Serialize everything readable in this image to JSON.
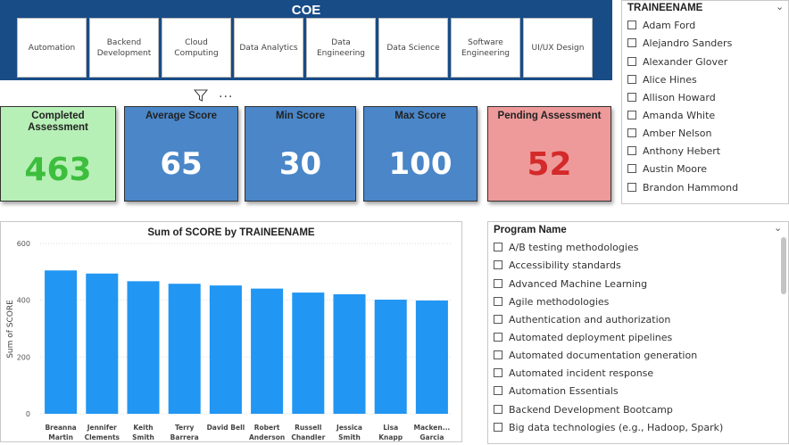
{
  "coe": {
    "title": "COE",
    "buttons": [
      "Automation",
      "Backend Development",
      "Cloud Computing",
      "Data Analytics",
      "Data Engineering",
      "Data Science",
      "Software Engineering",
      "UI/UX Design"
    ]
  },
  "toolbar": {
    "more": "..."
  },
  "kpis": {
    "completed": {
      "label": "Completed Assessment",
      "value": "463",
      "bg": "#b7f0b7",
      "fg": "#3dbe3d"
    },
    "average": {
      "label": "Average Score",
      "value": "65",
      "bg": "#4a86c8",
      "fg": "#ffffff"
    },
    "min": {
      "label": "Min Score",
      "value": "30",
      "bg": "#4a86c8",
      "fg": "#ffffff"
    },
    "max": {
      "label": "Max Score",
      "value": "100",
      "bg": "#4a86c8",
      "fg": "#ffffff"
    },
    "pending": {
      "label": "Pending Assessment",
      "value": "52",
      "bg": "#ee9a9a",
      "fg": "#d42a2a"
    }
  },
  "trainee_slicer": {
    "title": "TRAINEENAME",
    "items": [
      "Adam Ford",
      "Alejandro Sanders",
      "Alexander Glover",
      "Alice Hines",
      "Allison Howard",
      "Amanda White",
      "Amber Nelson",
      "Anthony Hebert",
      "Austin Moore",
      "Brandon Hammond"
    ]
  },
  "program_slicer": {
    "title": "Program Name",
    "items": [
      "A/B testing methodologies",
      "Accessibility standards",
      "Advanced Machine Learning",
      "Agile methodologies",
      "Authentication and authorization",
      "Automated deployment pipelines",
      "Automated documentation generation",
      "Automated incident response",
      "Automation Essentials",
      "Backend Development Bootcamp",
      "Big data technologies (e.g., Hadoop, Spark)"
    ]
  },
  "chart_data": {
    "type": "bar",
    "title": "Sum of SCORE by TRAINEENAME",
    "xlabel": "",
    "ylabel": "Sum of SCORE",
    "categories": [
      [
        "Breanna",
        "Martin"
      ],
      [
        "Jennifer",
        "Clements"
      ],
      [
        "Keith",
        "Smith"
      ],
      [
        "Terry",
        "Barrera"
      ],
      [
        "David Bell"
      ],
      [
        "Robert",
        "Anderson"
      ],
      [
        "Russell",
        "Chandler"
      ],
      [
        "Jessica",
        "Smith"
      ],
      [
        "Lisa",
        "Knapp"
      ],
      [
        "Macken...",
        "Garcia"
      ]
    ],
    "values": [
      505,
      494,
      467,
      458,
      452,
      441,
      427,
      421,
      402,
      399
    ],
    "yticks": [
      0,
      200,
      400,
      600
    ],
    "ylim": [
      0,
      600
    ],
    "bar_color": "#2196f3",
    "grid": true
  }
}
